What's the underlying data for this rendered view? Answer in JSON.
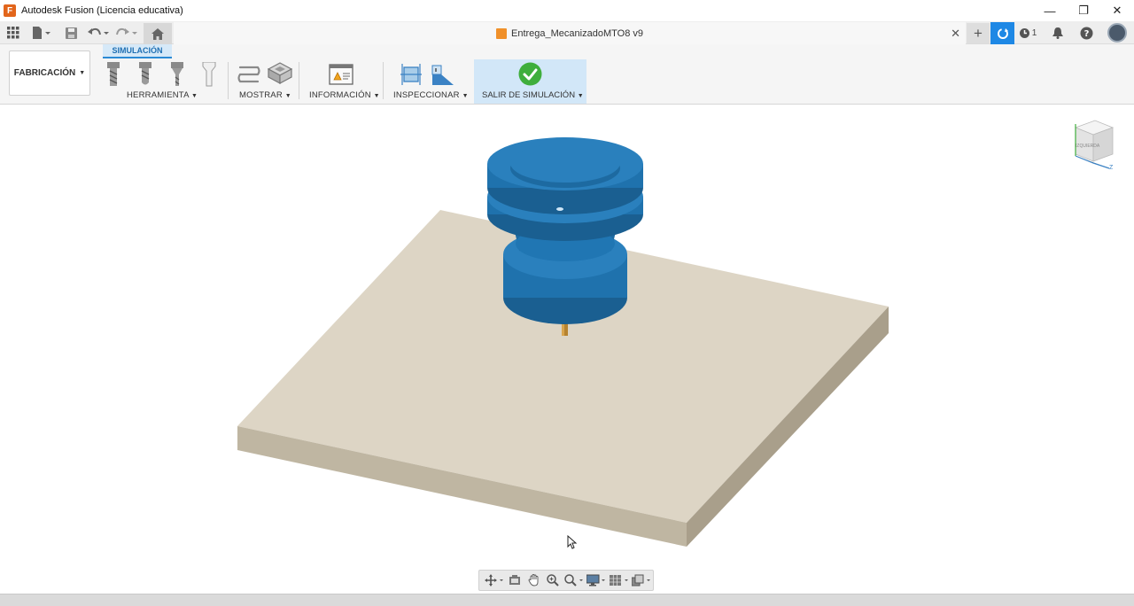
{
  "titlebar": {
    "title": "Autodesk Fusion (Licencia educativa)",
    "minimize": "—",
    "restore": "❐",
    "close": "✕"
  },
  "document": {
    "name": "Entrega_MecanizadoMTO8 v9",
    "close": "✕"
  },
  "notifications": {
    "job_count": "1"
  },
  "ribbon": {
    "workspace": "FABRICACIÓN",
    "active_tab": "SIMULACIÓN",
    "groups": {
      "herramienta": "HERRAMIENTA",
      "mostrar": "MOSTRAR",
      "informacion": "INFORMACIÓN",
      "inspeccionar": "INSPECCIONAR",
      "salir": "SALIR DE SIMULACIÓN"
    }
  },
  "viewcube": {
    "face": "IZQUIERDA",
    "axis_z": "Z"
  },
  "colors": {
    "accent": "#1e88e5",
    "tool_blue": "#1f72ad",
    "stock": "#dcd3c3",
    "exit_check": "#3fae3c"
  }
}
